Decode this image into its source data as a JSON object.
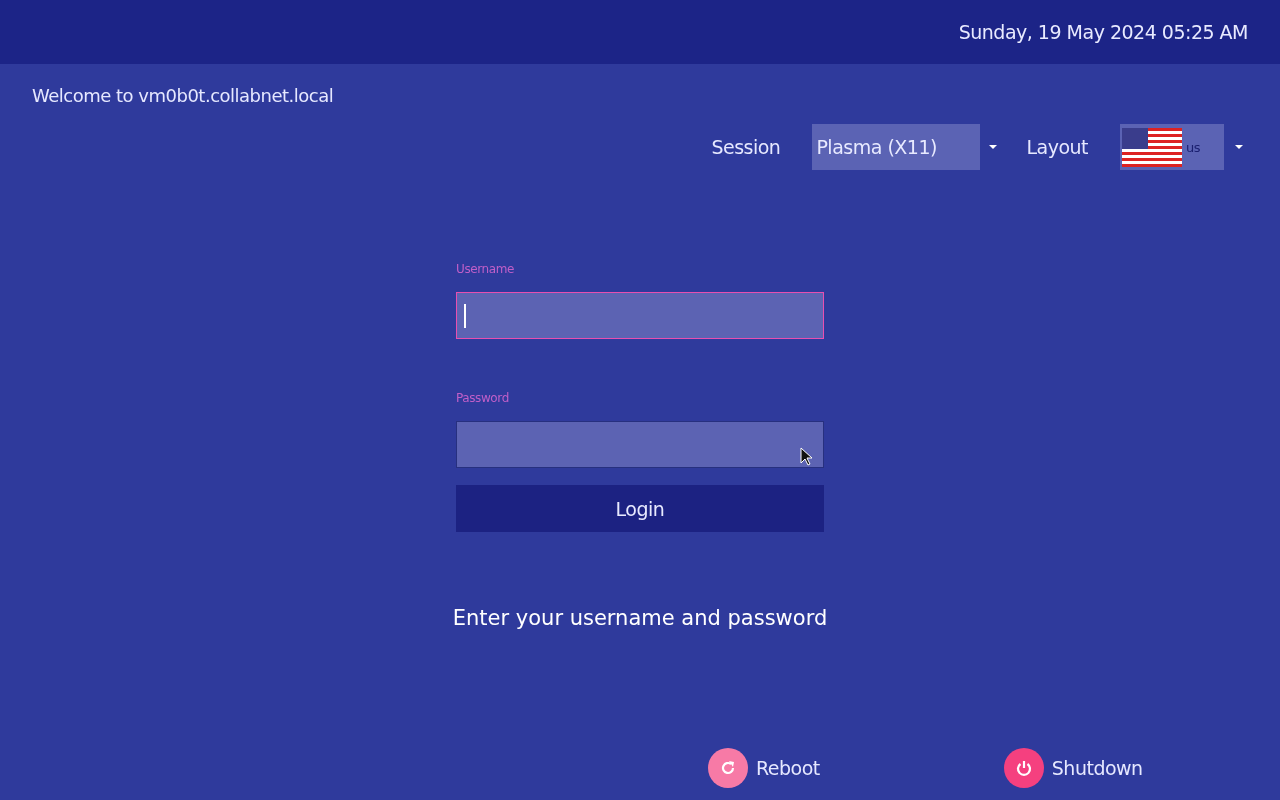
{
  "top_bar": {
    "datetime": "Sunday, 19 May 2024  05:25 AM"
  },
  "welcome": "Welcome to vm0b0t.collabnet.local",
  "session": {
    "label": "Session",
    "value": "Plasma (X11)"
  },
  "layout": {
    "label": "Layout",
    "value": "us"
  },
  "fields": [
    {
      "label": "Username",
      "focused": true
    },
    {
      "label": "Password",
      "focused": false
    }
  ],
  "login_button": "Login",
  "message": "Enter your username and password",
  "actions": [
    {
      "label": "Reboot",
      "kind": "reboot",
      "color": "#f77aa6"
    },
    {
      "label": "Shutdown",
      "kind": "shutdown",
      "color": "#f5407f"
    }
  ]
}
